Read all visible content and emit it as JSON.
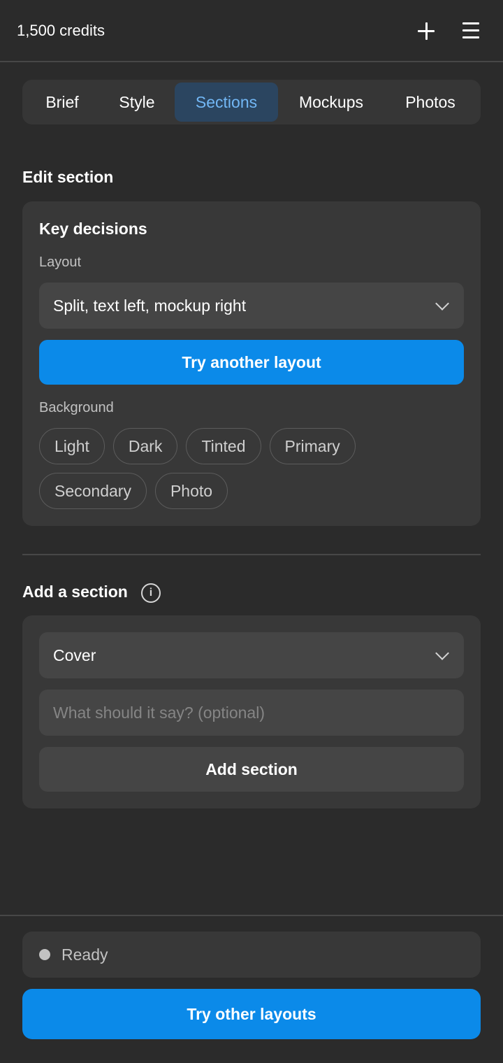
{
  "header": {
    "credits": "1,500 credits",
    "add_icon": "plus-icon",
    "menu_icon": "menu-icon"
  },
  "tabs": [
    {
      "label": "Brief",
      "active": false
    },
    {
      "label": "Style",
      "active": false
    },
    {
      "label": "Sections",
      "active": true
    },
    {
      "label": "Mockups",
      "active": false
    },
    {
      "label": "Photos",
      "active": false
    }
  ],
  "edit_section": {
    "title": "Edit section",
    "card_title": "Key decisions",
    "layout_label": "Layout",
    "layout_value": "Split, text left, mockup right",
    "try_button": "Try another layout",
    "background_label": "Background",
    "background_options": [
      "Light",
      "Dark",
      "Tinted",
      "Primary",
      "Secondary",
      "Photo"
    ]
  },
  "add_section": {
    "title": "Add a section",
    "info_icon": "info-icon",
    "type_value": "Cover",
    "text_placeholder": "What should it say? (optional)",
    "text_value": "",
    "add_button": "Add section"
  },
  "footer": {
    "status": "Ready",
    "primary_button": "Try other layouts"
  },
  "colors": {
    "background": "#2b2b2b",
    "card": "#383838",
    "field": "#454545",
    "accent": "#0b8ae9",
    "active_tab_bg": "#2b4560",
    "active_tab_text": "#72b7f5"
  }
}
